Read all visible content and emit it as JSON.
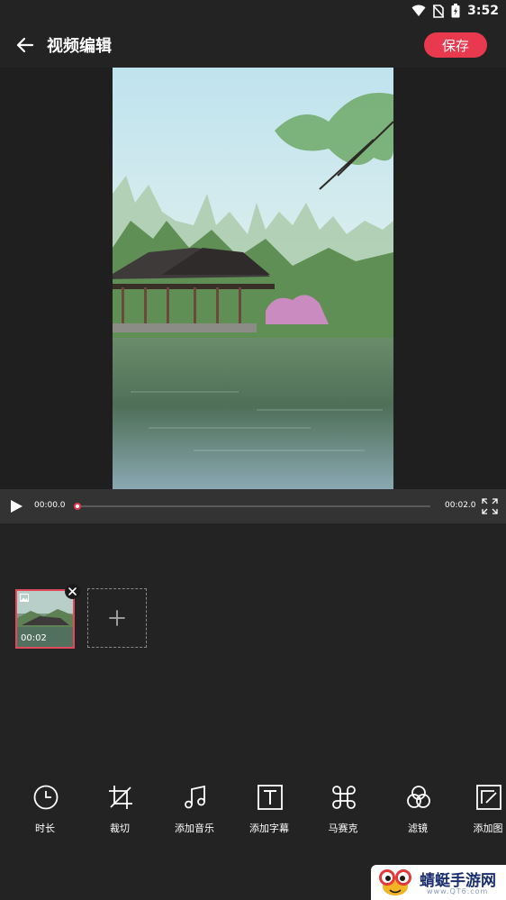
{
  "status_bar": {
    "time": "3:52",
    "icons": [
      "wifi-icon",
      "no-sim-icon",
      "battery-charging-icon"
    ]
  },
  "header": {
    "title": "视频编辑",
    "back_icon": "arrow-left-icon",
    "save_label": "保存",
    "accent_color": "#e8394f"
  },
  "player": {
    "current_time": "00:00.0",
    "total_time": "00:02.0",
    "progress": 0,
    "play_icon": "play-icon",
    "fullscreen_icon": "fullscreen-icon"
  },
  "timeline": {
    "clips": [
      {
        "duration": "00:02",
        "thumb_icon": "image-icon",
        "remove_icon": "close-icon"
      }
    ],
    "add_icon": "plus-icon"
  },
  "tools": [
    {
      "label": "时长",
      "icon": "clock-icon"
    },
    {
      "label": "裁切",
      "icon": "crop-icon"
    },
    {
      "label": "添加音乐",
      "icon": "music-note-icon"
    },
    {
      "label": "添加字幕",
      "icon": "text-box-icon"
    },
    {
      "label": "马赛克",
      "icon": "mosaic-icon"
    },
    {
      "label": "滤镜",
      "icon": "filter-circles-icon"
    },
    {
      "label": "添加图",
      "icon": "add-image-icon"
    }
  ],
  "watermark": {
    "text": "蜻蜓手游网",
    "url": "www.QT6.com"
  }
}
